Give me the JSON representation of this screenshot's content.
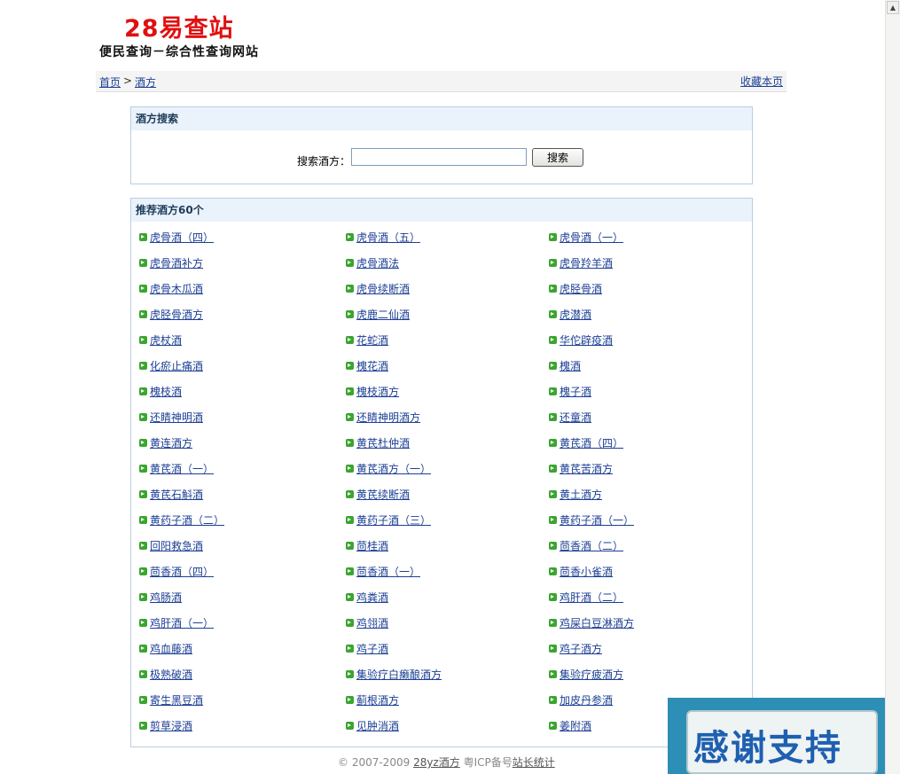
{
  "site": {
    "logo": "28易查站",
    "slogan": "便民查询－综合性查询网站"
  },
  "breadcrumb": {
    "home": "首页",
    "sep": ">",
    "current": "酒方",
    "favorite": "收藏本页"
  },
  "search": {
    "title": "酒方搜索",
    "label": "搜索酒方：",
    "input_value": "",
    "button": "搜索"
  },
  "list": {
    "title": "推荐酒方60个",
    "items": [
      "虎骨酒（四）",
      "虎骨酒（五）",
      "虎骨酒（一）",
      "虎骨酒补方",
      "虎骨酒法",
      "虎骨羚羊酒",
      "虎骨木瓜酒",
      "虎骨续断酒",
      "虎胫骨酒",
      "虎胫骨酒方",
      "虎鹿二仙酒",
      "虎潜酒",
      "虎杖酒",
      "花蛇酒",
      "华佗辟疫酒",
      "化瘀止痛酒",
      "槐花酒",
      "槐酒",
      "槐枝酒",
      "槐枝酒方",
      "槐子酒",
      "还睛神明酒",
      "还睛神明酒方",
      "还童酒",
      "黄连酒方",
      "黄芪杜仲酒",
      "黄芪酒（四）",
      "黄芪酒（一）",
      "黄芪酒方（一）",
      "黄芪苦酒方",
      "黄芪石斛酒",
      "黄芪续断酒",
      "黄土酒方",
      "黄药子酒（二）",
      "黄药子酒（三）",
      "黄药子酒（一）",
      "回阳救急酒",
      "茴桂酒",
      "茴香酒（二）",
      "茴香酒（四）",
      "茴香酒（一）",
      "茴香小雀酒",
      "鸡肠酒",
      "鸡粪酒",
      "鸡肝酒（二）",
      "鸡肝酒（一）",
      "鸡翎酒",
      "鸡屎白豆淋酒方",
      "鸡血藤酒",
      "鸡子酒",
      "鸡子酒方",
      "极熟破酒",
      "集验疗白癞酿酒方",
      "集验疗疲酒方",
      "寄生黑豆酒",
      "蓟根酒方",
      "加皮丹参酒",
      "剪草浸酒",
      "见肿消酒",
      "姜附酒"
    ]
  },
  "footer": {
    "copyright": "© 2007-2009",
    "site_link": "28yz酒方",
    "icp": "粤ICP备号",
    "stats": "站长统计"
  },
  "banner": {
    "text": "感谢支持"
  }
}
